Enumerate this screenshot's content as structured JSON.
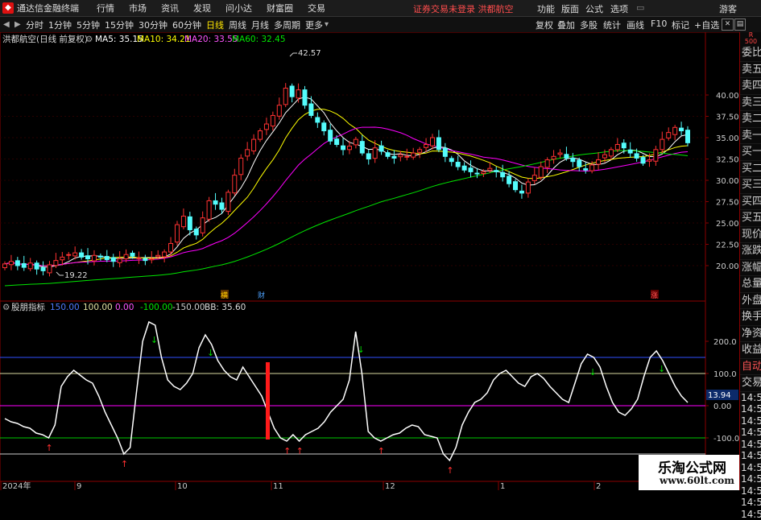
{
  "menubar": {
    "app_title": "通达信金融终端",
    "items": [
      "行情",
      "市场",
      "资讯",
      "发现",
      "问小达",
      "财富圈",
      "交易"
    ],
    "alert": "证券交易未登录  洪都航空",
    "right_items": [
      "功能",
      "版面",
      "公式",
      "选项"
    ],
    "guest": "游客"
  },
  "toolbar": {
    "periods": [
      "分时",
      "1分钟",
      "5分钟",
      "15分钟",
      "30分钟",
      "60分钟",
      "日线",
      "周线",
      "月线",
      "多周期",
      "更多"
    ],
    "active_period": "日线",
    "tools": [
      "复权",
      "叠加",
      "多股",
      "统计",
      "画线",
      "F10",
      "标记",
      "+自选"
    ]
  },
  "main_legend": {
    "title": "洪都航空(日线 前复权)",
    "ma5": "MA5: 35.15",
    "ma10": "MA10: 34.21",
    "ma20": "MA20: 33.55",
    "ma60": "MA60: 32.45"
  },
  "sub_legend": {
    "name": "股朋指标",
    "v1": "150.00",
    "v2": "100.00",
    "v3": "0.00",
    "v4": "-100.00",
    "v5": "-150.00",
    "bb": "BB: 35.60"
  },
  "chart_data": {
    "type": "candlestick",
    "y_ticks": [
      "40.00",
      "37.50",
      "35.00",
      "32.50",
      "30.00",
      "27.50",
      "25.00",
      "22.50",
      "20.00"
    ],
    "annotations": [
      "42.57",
      "19.22"
    ],
    "event_markers": [
      "横",
      "财",
      "涨"
    ],
    "sub_y_ticks": [
      "200.0",
      "100.0",
      "0.00",
      "-100.0"
    ],
    "sub_current_value": "13.94",
    "x_labels": [
      "2024年",
      "9",
      "10",
      "11",
      "12",
      "1",
      "2"
    ],
    "ohlc_close": [
      20.2,
      20.5,
      20.0,
      19.8,
      20.3,
      19.6,
      19.4,
      20.1,
      20.6,
      21.0,
      21.3,
      21.5,
      21.0,
      20.8,
      21.2,
      21.0,
      20.7,
      20.5,
      20.8,
      21.3,
      21.1,
      20.9,
      20.6,
      20.8,
      21.2,
      21.6,
      22.6,
      24.8,
      25.8,
      24.2,
      23.6,
      25.6,
      27.6,
      27.2,
      26.6,
      28.6,
      30.6,
      32.6,
      33.6,
      34.8,
      35.8,
      36.6,
      37.6,
      38.8,
      40.8,
      39.8,
      40.6,
      38.8,
      37.6,
      36.8,
      35.8,
      34.6,
      34.2,
      33.6,
      34.0,
      34.8,
      33.2,
      32.5,
      33.8,
      33.4,
      32.8,
      32.6,
      33.0,
      32.8,
      33.2,
      33.6,
      34.2,
      35.0,
      33.6,
      32.8,
      32.2,
      31.6,
      31.2,
      31.0,
      30.8,
      31.0,
      31.4,
      31.0,
      30.4,
      29.6,
      28.9,
      28.5,
      29.8,
      30.6,
      31.6,
      32.4,
      32.8,
      33.2,
      32.6,
      32.2,
      31.6,
      31.2,
      31.8,
      32.4,
      33.0,
      33.6,
      34.2,
      33.8,
      33.2,
      32.6,
      32.0,
      32.4,
      33.6,
      34.8,
      35.6,
      36.2,
      35.8,
      34.4
    ],
    "oscillator": [
      -40,
      -50,
      -55,
      -65,
      -70,
      -85,
      -90,
      -100,
      -60,
      60,
      90,
      110,
      95,
      80,
      70,
      30,
      -20,
      -60,
      -100,
      -150,
      -130,
      40,
      200,
      260,
      250,
      150,
      80,
      60,
      50,
      70,
      100,
      180,
      220,
      190,
      140,
      110,
      90,
      80,
      120,
      90,
      60,
      30,
      -20,
      -70,
      -100,
      -110,
      -90,
      -110,
      -90,
      -80,
      -70,
      -50,
      -20,
      0,
      20,
      80,
      230,
      100,
      -80,
      -100,
      -110,
      -100,
      -90,
      -85,
      -70,
      -60,
      -65,
      -90,
      -95,
      -100,
      -150,
      -170,
      -130,
      -60,
      -20,
      10,
      20,
      40,
      80,
      100,
      110,
      90,
      70,
      60,
      90,
      100,
      85,
      60,
      40,
      20,
      10,
      70,
      130,
      160,
      150,
      120,
      60,
      10,
      -20,
      -30,
      -10,
      20,
      90,
      150,
      170,
      140,
      100,
      60,
      30,
      10
    ]
  },
  "sidebar": {
    "top_label": "R\n500",
    "items": [
      "委比",
      "卖五",
      "卖四",
      "卖三",
      "卖二",
      "卖一",
      "买一",
      "买二",
      "买三",
      "买四",
      "买五",
      "现价",
      "涨跌",
      "涨幅",
      "总量",
      "外盘",
      "换手",
      "净资",
      "收益"
    ],
    "bottom_items": [
      "自动",
      "交易"
    ],
    "times": [
      "14:56",
      "14:56",
      "14:56",
      "14:56",
      "14:56",
      "14:56",
      "14:56",
      "14:56",
      "14:56",
      "14:56",
      "14:56"
    ]
  },
  "watermark": {
    "line1": "乐淘公式网",
    "line2": "www.60lt.com"
  },
  "colors": {
    "up": "#ff3232",
    "down": "#54fcfc",
    "ma5": "#ffffff",
    "ma10": "#ffff00",
    "ma20": "#ff00ff",
    "ma60": "#00e600"
  }
}
